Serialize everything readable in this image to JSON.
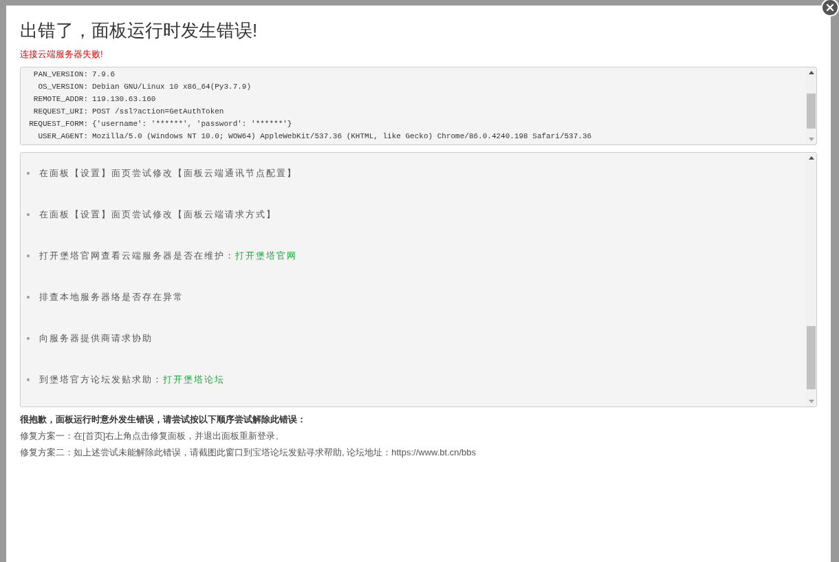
{
  "dialog": {
    "title": "出错了，面板运行时发生错误!",
    "error_message": "连接云端服务器失败!"
  },
  "debug_info": [
    {
      "key": "PAN_VERSION:",
      "value": "7.9.6"
    },
    {
      "key": "OS_VERSION:",
      "value": "Debian GNU/Linux 10 x86_64(Py3.7.9)"
    },
    {
      "key": "REMOTE_ADDR:",
      "value": "119.130.63.160"
    },
    {
      "key": "REQUEST_URI:",
      "value": "POST /ssl?action=GetAuthToken"
    },
    {
      "key": "REQUEST_FORM:",
      "value": "{'username': '******', 'password': '******'}"
    },
    {
      "key": "USER_AGENT:",
      "value": "Mozilla/5.0 (Windows NT 10.0; WOW64) AppleWebKit/537.36 (KHTML, like Gecko) Chrome/86.0.4240.198 Safari/537.36"
    }
  ],
  "suggestions": [
    {
      "text": "在面板【设置】面页尝试修改【面板云端通讯节点配置】"
    },
    {
      "text": "在面板【设置】面页尝试修改【面板云端请求方式】"
    },
    {
      "text": "打开堡塔官网查看云端服务器是否在维护：",
      "link": "打开堡塔官网"
    },
    {
      "text": "排查本地服务器络是否存在异常"
    },
    {
      "text": "向服务器提供商请求协助"
    },
    {
      "text": "到堡塔官方论坛发贴求助：",
      "link": "打开堡塔论坛"
    }
  ],
  "help": {
    "heading": "很抱歉，面板运行时意外发生错误，请尝试按以下顺序尝试解除此错误：",
    "lines": [
      "修复方案一：在[首页]右上角点击修复面板，并退出面板重新登录。",
      "修复方案二：如上述尝试未能解除此错误，请截图此窗口到宝塔论坛发贴寻求帮助, 论坛地址：https://www.bt.cn/bbs"
    ]
  }
}
